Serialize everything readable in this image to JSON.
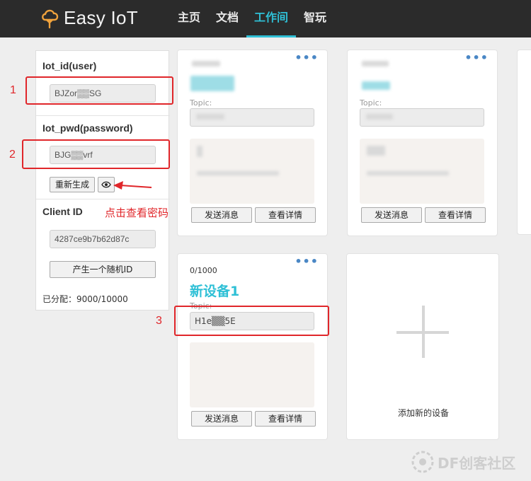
{
  "header": {
    "logo_text": "Easy IoT",
    "nav": [
      {
        "label": "主页"
      },
      {
        "label": "文档"
      },
      {
        "label": "工作间"
      },
      {
        "label": "智玩"
      }
    ],
    "active_nav": "工作间"
  },
  "sidebar": {
    "iot_id_label": "Iot_id(user)",
    "iot_id_value": "BJZor▒▒SG",
    "iot_pwd_label": "Iot_pwd(password)",
    "iot_pwd_value": "BJG▒▒vrf",
    "regenerate_label": "重新生成",
    "show_password_icon": "eye-icon",
    "client_id_label": "Client ID",
    "client_id_value": "4287ce9b7b62d87c",
    "random_id_label": "产生一个随机ID",
    "quota_text": "已分配：9000/10000"
  },
  "cards": [
    {
      "topic_label": "Topic:",
      "send_label": "发送消息",
      "detail_label": "查看详情"
    },
    {
      "topic_label": "Topic:",
      "send_label": "发送消息",
      "detail_label": "查看详情"
    },
    {
      "counter": "0/1000",
      "name": "新设备1",
      "topic_label": "Topic:",
      "topic_value": "H1e▒▒5E",
      "send_label": "发送消息",
      "detail_label": "查看详情"
    }
  ],
  "add_card": {
    "label": "添加新的设备"
  },
  "annotations": {
    "n1": "1",
    "n2": "2",
    "n3": "3",
    "hint": "点击查看密码"
  },
  "watermark": "DF创客社区",
  "colors": {
    "accent": "#2fc0d6",
    "annotation_red": "#e0262a",
    "topbar": "#2b2b2b"
  }
}
